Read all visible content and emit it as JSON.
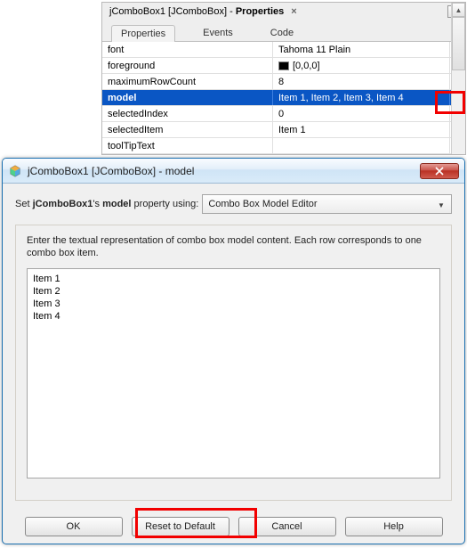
{
  "panel": {
    "title_prefix": "jComboBox1 [JComboBox] - ",
    "title_bold": "Properties",
    "tabs": {
      "t0": "Properties",
      "t1": "Events",
      "t2": "Code"
    },
    "rows": [
      {
        "name": "font",
        "value": "Tahoma 11 Plain",
        "selected": false
      },
      {
        "name": "foreground",
        "value": "[0,0,0]",
        "selected": false,
        "swatch": true
      },
      {
        "name": "maximumRowCount",
        "value": "8",
        "selected": false
      },
      {
        "name": "model",
        "value": "Item 1, Item 2, Item 3, Item 4",
        "selected": true
      },
      {
        "name": "selectedIndex",
        "value": "0",
        "selected": false
      },
      {
        "name": "selectedItem",
        "value": "Item 1",
        "selected": false
      },
      {
        "name": "toolTipText",
        "value": "",
        "selected": false
      }
    ]
  },
  "dialog": {
    "title": "jComboBox1 [JComboBox] - model",
    "set_prefix": "Set ",
    "set_bold1": "jComboBox1",
    "set_mid": "'s ",
    "set_bold2": "model",
    "set_suffix": " property using:",
    "combo_value": "Combo Box Model Editor",
    "desc": "Enter the textual representation of combo box model content. Each row corresponds to one combo box item.",
    "textarea": "Item 1\nItem 2\nItem 3\nItem 4",
    "buttons": {
      "ok": "OK",
      "reset": "Reset to Default",
      "cancel": "Cancel",
      "help": "Help"
    }
  }
}
